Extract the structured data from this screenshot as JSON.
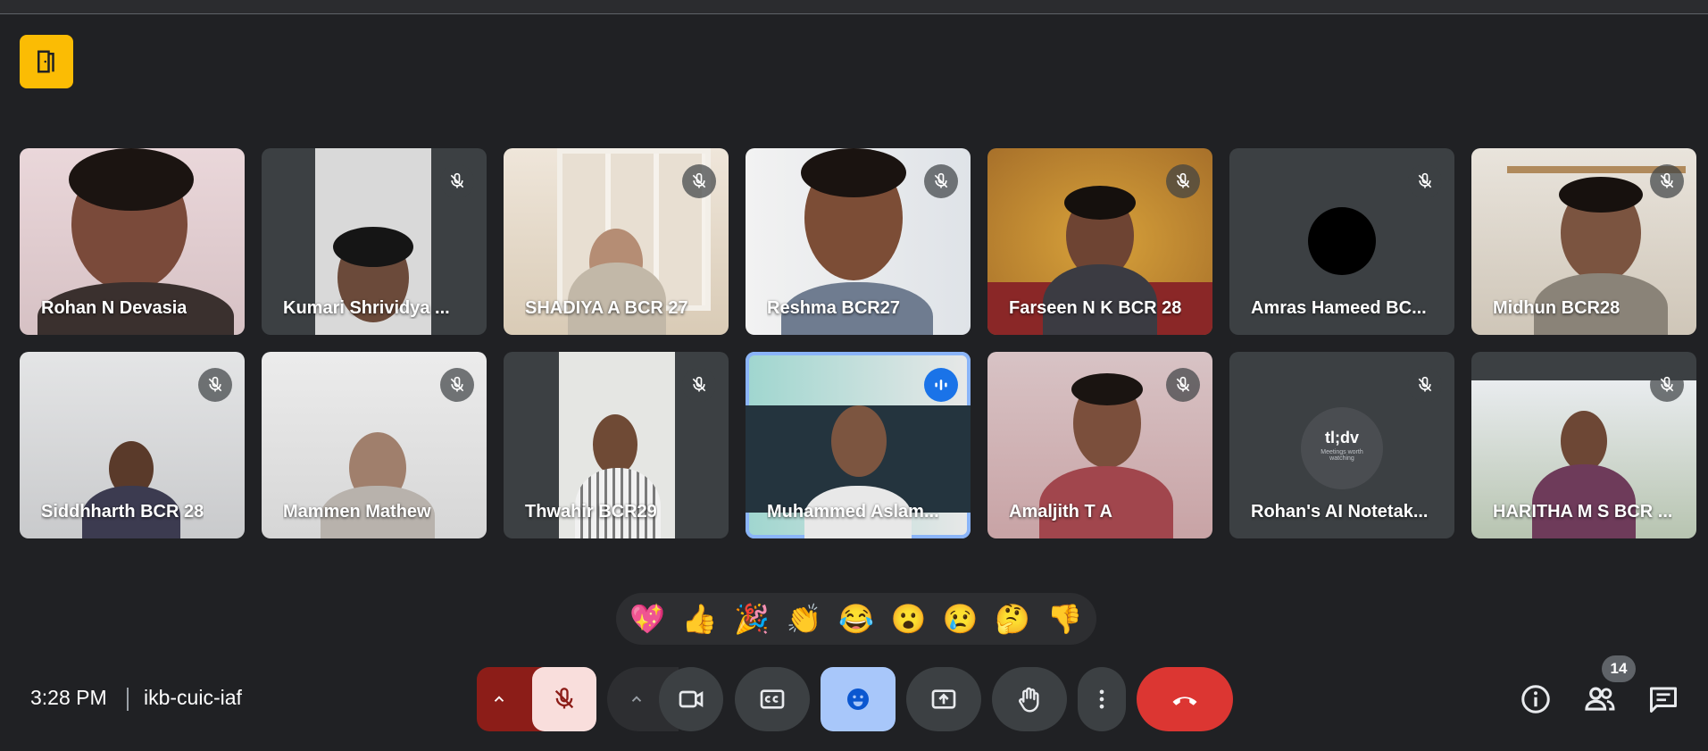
{
  "meeting": {
    "time": "3:28 PM",
    "code": "ikb-cuic-iaf",
    "participant_count": "14"
  },
  "participants": [
    {
      "name": "Rohan N Devasia"
    },
    {
      "name": "Kumari Shrividya ..."
    },
    {
      "name": "SHADIYA A BCR 27"
    },
    {
      "name": "Reshma BCR27"
    },
    {
      "name": "Farseen N K BCR 28"
    },
    {
      "name": "Amras Hameed BC..."
    },
    {
      "name": "Midhun BCR28"
    },
    {
      "name": "Siddhharth BCR 28"
    },
    {
      "name": "Mammen Mathew"
    },
    {
      "name": "Thwahir BCR29"
    },
    {
      "name": "Muhammed Aslam..."
    },
    {
      "name": "Amaljith T A"
    },
    {
      "name": "Rohan's AI Notetak..."
    },
    {
      "name": "HARITHA M S BCR ..."
    }
  ],
  "notetaker": {
    "logo_text": "tl;dv",
    "tagline": "Meetings worth watching"
  },
  "reactions": [
    "💖",
    "👍",
    "🎉",
    "👏",
    "😂",
    "😮",
    "😢",
    "🤔",
    "👎"
  ],
  "colors": {
    "background": "#202124",
    "hangup": "#dc3632",
    "active_speaker": "#8ab4f8",
    "mic_off": "#f9dedc",
    "reaction_btn": "#a8c7fa",
    "badge": "#fbbc04"
  }
}
